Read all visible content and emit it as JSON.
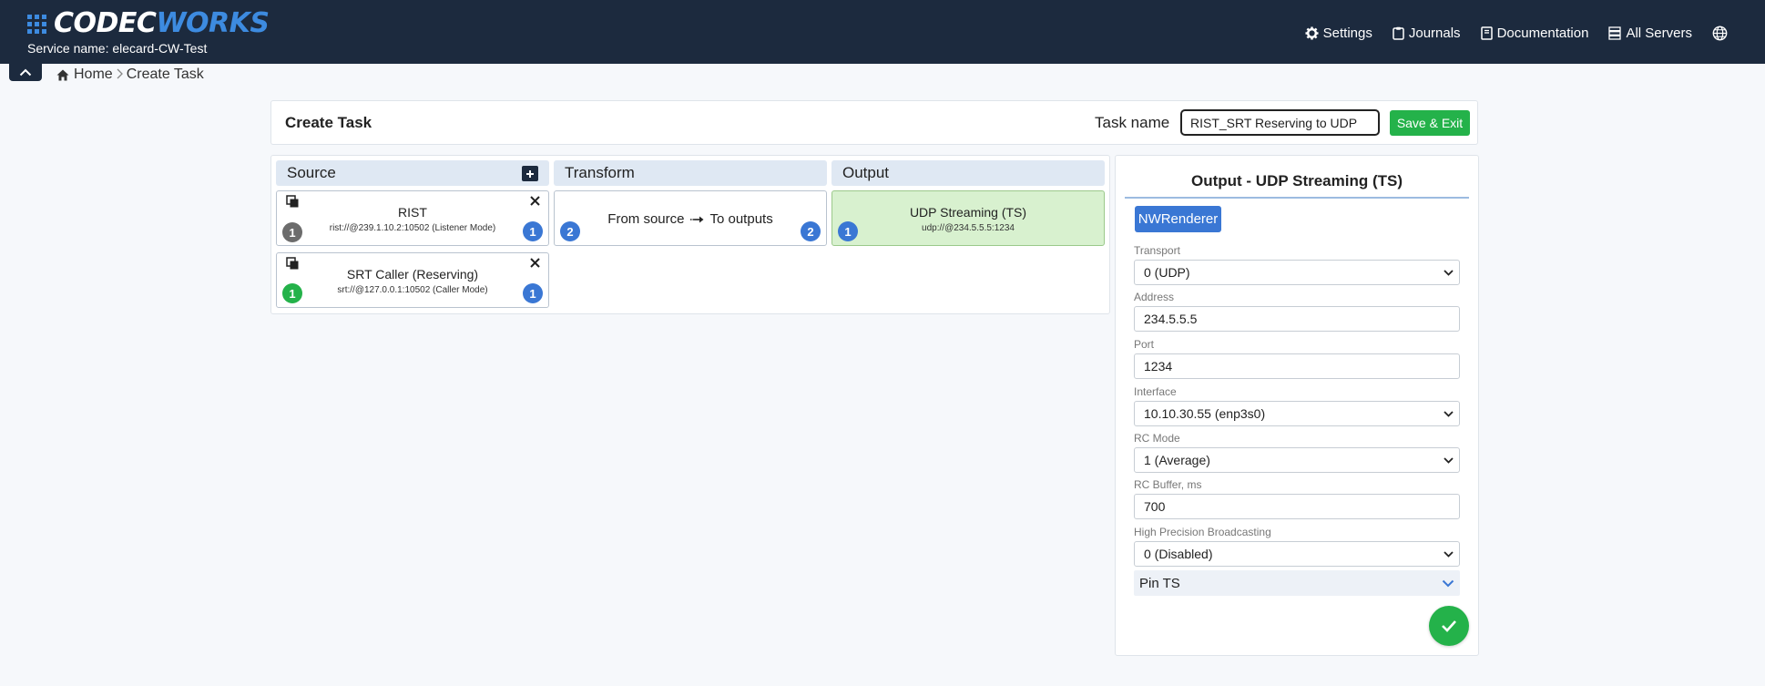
{
  "brand": {
    "part1": "CODEC",
    "part2": "WORKS",
    "service_label": "Service name: elecard-CW-Test"
  },
  "nav": {
    "settings": "Settings",
    "journals": "Journals",
    "documentation": "Documentation",
    "all_servers": "All Servers"
  },
  "breadcrumb": {
    "home": "Home",
    "current": "Create Task"
  },
  "task": {
    "title": "Create Task",
    "name_label": "Task name",
    "name_value": "RIST_SRT Reserving to UDP",
    "save_label": "Save & Exit"
  },
  "columns": {
    "source": "Source",
    "transform": "Transform",
    "output": "Output"
  },
  "sources": [
    {
      "title": "RIST",
      "url": "rist://@239.1.10.2:10502 (Listener Mode)",
      "left_badge": "1",
      "right_badge": "1"
    },
    {
      "title": "SRT Caller (Reserving)",
      "url": "srt://@127.0.0.1:10502 (Caller Mode)",
      "left_badge": "1",
      "right_badge": "1"
    }
  ],
  "transform": {
    "from": "From source",
    "to": "To outputs",
    "left_badge": "2",
    "right_badge": "2"
  },
  "output": {
    "title": "UDP Streaming (TS)",
    "url": "udp://@234.5.5.5:1234",
    "badge": "1"
  },
  "panel": {
    "title": "Output - UDP Streaming (TS)",
    "renderer": "NWRenderer",
    "transport_label": "Transport",
    "transport_value": "0 (UDP)",
    "address_label": "Address",
    "address_value": "234.5.5.5",
    "port_label": "Port",
    "port_value": "1234",
    "interface_label": "Interface",
    "interface_value": "10.10.30.55 (enp3s0)",
    "rc_mode_label": "RC Mode",
    "rc_mode_value": "1 (Average)",
    "rc_buffer_label": "RC Buffer, ms",
    "rc_buffer_value": "700",
    "hpb_label": "High Precision Broadcasting",
    "hpb_value": "0 (Disabled)",
    "pin_ts": "Pin TS"
  },
  "colors": {
    "header_bg": "#1c2a3e",
    "accent_blue": "#3a77d4",
    "success_green": "#24b24a",
    "selected_bg": "#d8f1cf"
  }
}
